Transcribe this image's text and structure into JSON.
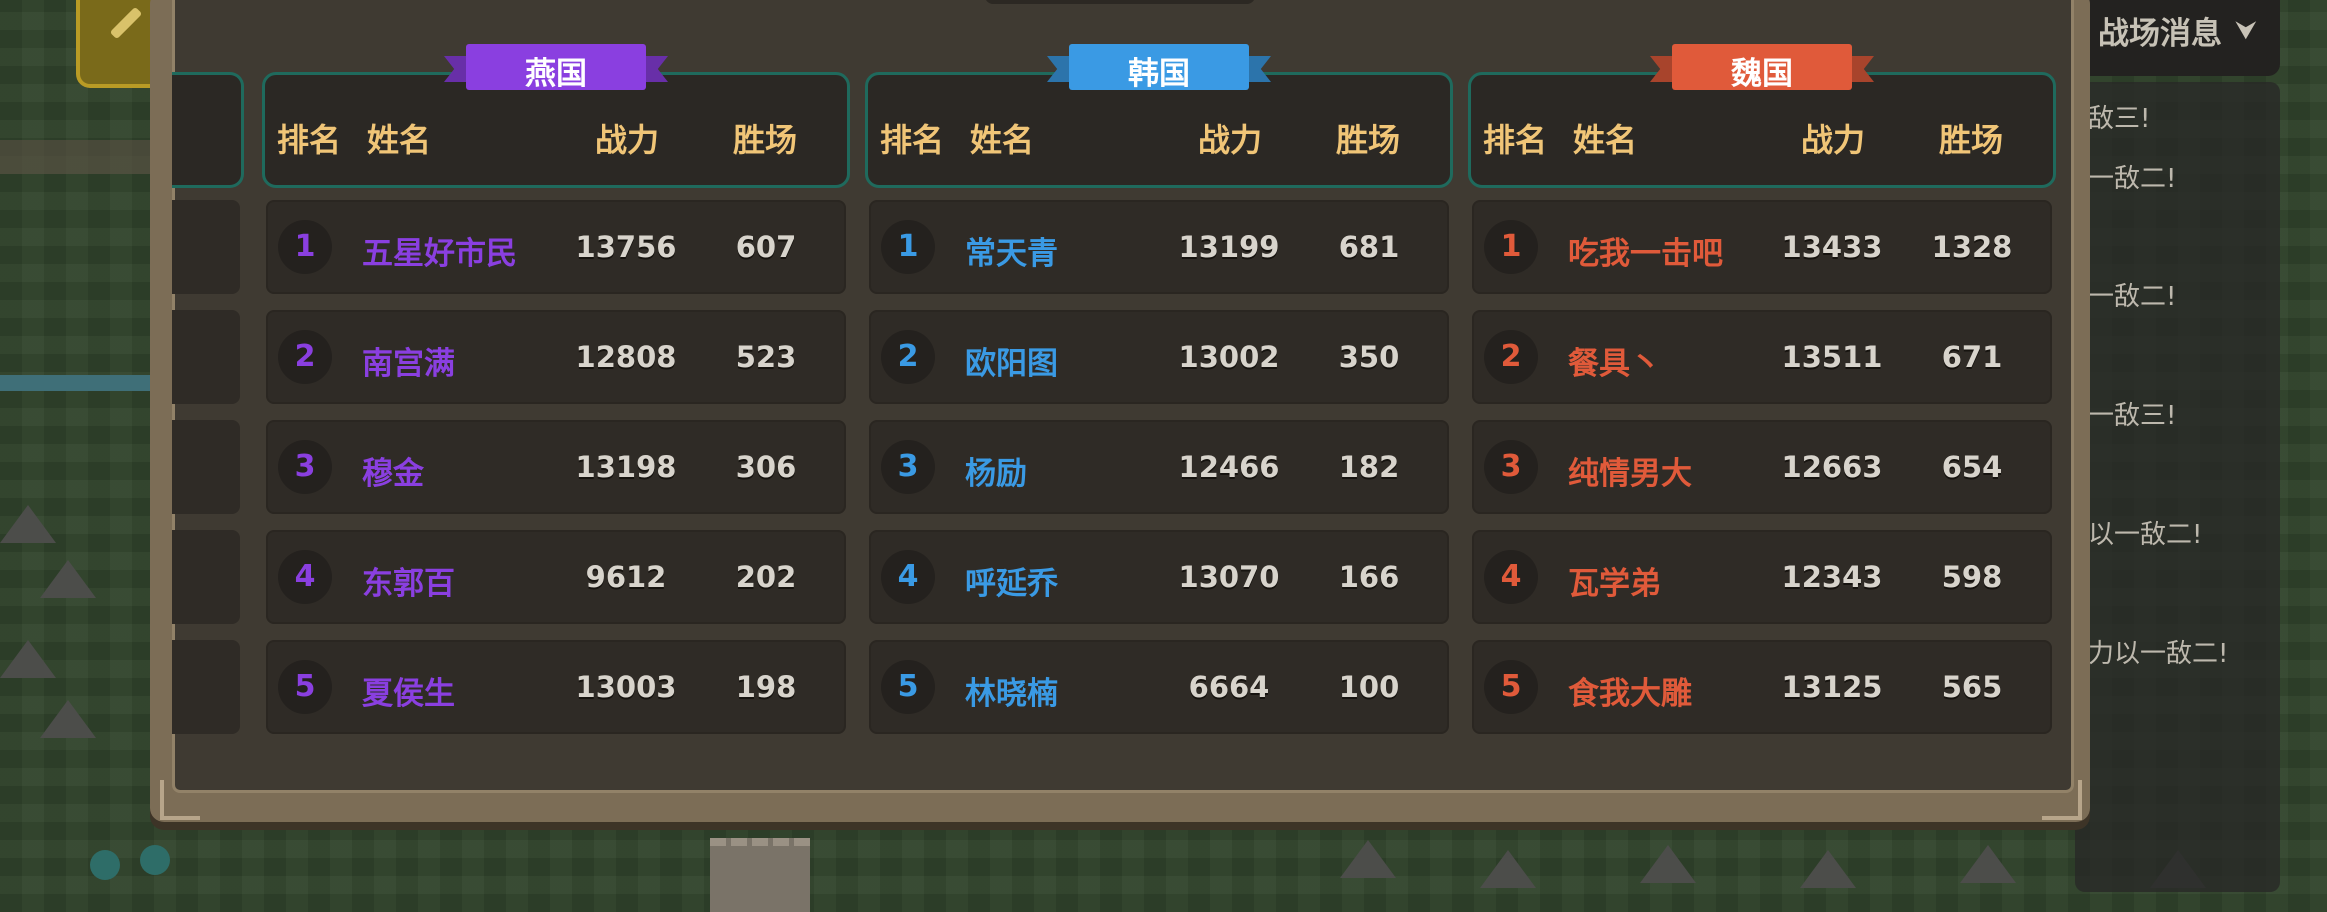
{
  "messages": {
    "title": "战场消息",
    "lines": [
      "敌三!",
      "一敌二!",
      "一敌二!",
      "一敌三!",
      "以一敌二!",
      "力以一敌二!"
    ]
  },
  "headers": {
    "rank": "排名",
    "name": "姓名",
    "power": "战力",
    "wins": "胜场"
  },
  "factions": [
    {
      "name": "燕国",
      "color": "#8a3fe0",
      "rows": [
        {
          "rank": "1",
          "name": "五星好市民",
          "power": "13756",
          "wins": "607"
        },
        {
          "rank": "2",
          "name": "南宫满",
          "power": "12808",
          "wins": "523"
        },
        {
          "rank": "3",
          "name": "穆金",
          "power": "13198",
          "wins": "306"
        },
        {
          "rank": "4",
          "name": "东郭百",
          "power": "9612",
          "wins": "202"
        },
        {
          "rank": "5",
          "name": "夏侯生",
          "power": "13003",
          "wins": "198"
        }
      ]
    },
    {
      "name": "韩国",
      "color": "#3a9ae4",
      "rows": [
        {
          "rank": "1",
          "name": "常天青",
          "power": "13199",
          "wins": "681"
        },
        {
          "rank": "2",
          "name": "欧阳图",
          "power": "13002",
          "wins": "350"
        },
        {
          "rank": "3",
          "name": "杨励",
          "power": "12466",
          "wins": "182"
        },
        {
          "rank": "4",
          "name": "呼延乔",
          "power": "13070",
          "wins": "166"
        },
        {
          "rank": "5",
          "name": "林晓楠",
          "power": "6664",
          "wins": "100"
        }
      ]
    },
    {
      "name": "魏国",
      "color": "#e05a3a",
      "rows": [
        {
          "rank": "1",
          "name": "吃我一击吧",
          "power": "13433",
          "wins": "1328"
        },
        {
          "rank": "2",
          "name": "餐具丶",
          "power": "13511",
          "wins": "671"
        },
        {
          "rank": "3",
          "name": "纯情男大",
          "power": "12663",
          "wins": "654"
        },
        {
          "rank": "4",
          "name": "瓦学弟",
          "power": "12343",
          "wins": "598"
        },
        {
          "rank": "5",
          "name": "食我大雕",
          "power": "13125",
          "wins": "565"
        }
      ]
    }
  ]
}
